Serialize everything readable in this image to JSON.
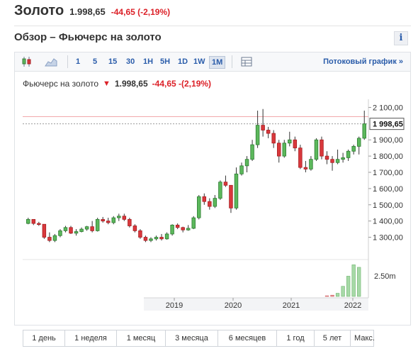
{
  "header": {
    "title": "Золото",
    "price": "1.998,65",
    "change": "-44,65 (-2,19%)"
  },
  "subtitle": "Обзор – Фьючерс на золото",
  "info_icon": "i",
  "toolbar": {
    "ranges": [
      "1",
      "5",
      "15",
      "30",
      "1H",
      "5H",
      "1D",
      "1W",
      "1M"
    ],
    "active_range": "1M",
    "stream_label": "Потоковый график  »"
  },
  "legend": {
    "name": "Фьючерс на золото",
    "price": "1.998,65",
    "change": "-44,65 -(2,19%)"
  },
  "chart_data": {
    "type": "candlestick",
    "instrument": "Фьючерс на золото",
    "last_price": "1 998,65",
    "y_ticks": [
      "2 100,00",
      "1 900,00",
      "1 800,00",
      "1 700,00",
      "1 600,00",
      "1 500,00",
      "1 400,00",
      "1 300,00"
    ],
    "y_range": [
      1180,
      2150
    ],
    "x_ticks": [
      "2019",
      "2020",
      "2021",
      "2022"
    ],
    "volume_label": "2.50m",
    "colors": {
      "up": "#5cb85c",
      "down": "#d9383c",
      "up_edge": "#2e7d32",
      "down_edge": "#a81e22"
    },
    "candles": [
      [
        1385,
        1420,
        1380,
        1410
      ],
      [
        1410,
        1410,
        1375,
        1385
      ],
      [
        1385,
        1395,
        1370,
        1380
      ],
      [
        1380,
        1380,
        1290,
        1300
      ],
      [
        1300,
        1330,
        1270,
        1280
      ],
      [
        1280,
        1320,
        1270,
        1310
      ],
      [
        1310,
        1350,
        1300,
        1340
      ],
      [
        1340,
        1370,
        1330,
        1360
      ],
      [
        1360,
        1370,
        1320,
        1325
      ],
      [
        1325,
        1350,
        1310,
        1335
      ],
      [
        1335,
        1360,
        1330,
        1350
      ],
      [
        1350,
        1370,
        1340,
        1365
      ],
      [
        1365,
        1400,
        1330,
        1340
      ],
      [
        1340,
        1420,
        1335,
        1410
      ],
      [
        1410,
        1425,
        1390,
        1400
      ],
      [
        1400,
        1420,
        1380,
        1390
      ],
      [
        1390,
        1430,
        1380,
        1420
      ],
      [
        1420,
        1445,
        1400,
        1430
      ],
      [
        1430,
        1445,
        1400,
        1410
      ],
      [
        1410,
        1420,
        1360,
        1370
      ],
      [
        1370,
        1380,
        1330,
        1340
      ],
      [
        1340,
        1350,
        1290,
        1300
      ],
      [
        1300,
        1310,
        1270,
        1280
      ],
      [
        1280,
        1300,
        1270,
        1290
      ],
      [
        1290,
        1310,
        1280,
        1300
      ],
      [
        1300,
        1320,
        1280,
        1290
      ],
      [
        1290,
        1330,
        1285,
        1320
      ],
      [
        1320,
        1380,
        1310,
        1375
      ],
      [
        1375,
        1385,
        1350,
        1360
      ],
      [
        1360,
        1365,
        1330,
        1345
      ],
      [
        1345,
        1375,
        1340,
        1355
      ],
      [
        1355,
        1430,
        1350,
        1420
      ],
      [
        1420,
        1560,
        1410,
        1550
      ],
      [
        1550,
        1570,
        1500,
        1520
      ],
      [
        1520,
        1540,
        1470,
        1490
      ],
      [
        1490,
        1560,
        1480,
        1540
      ],
      [
        1540,
        1650,
        1530,
        1640
      ],
      [
        1640,
        1680,
        1610,
        1620
      ],
      [
        1620,
        1620,
        1450,
        1480
      ],
      [
        1480,
        1730,
        1470,
        1690
      ],
      [
        1690,
        1760,
        1680,
        1740
      ],
      [
        1740,
        1800,
        1700,
        1780
      ],
      [
        1780,
        1900,
        1770,
        1870
      ],
      [
        1870,
        2080,
        1850,
        1990
      ],
      [
        1990,
        2090,
        1920,
        1960
      ],
      [
        1960,
        1980,
        1910,
        1940
      ],
      [
        1940,
        1960,
        1850,
        1880
      ],
      [
        1880,
        1900,
        1760,
        1800
      ],
      [
        1800,
        1900,
        1790,
        1880
      ],
      [
        1880,
        1950,
        1860,
        1900
      ],
      [
        1900,
        1920,
        1830,
        1850
      ],
      [
        1850,
        1870,
        1720,
        1730
      ],
      [
        1730,
        1770,
        1700,
        1720
      ],
      [
        1720,
        1800,
        1710,
        1780
      ],
      [
        1780,
        1910,
        1770,
        1900
      ],
      [
        1900,
        1920,
        1780,
        1800
      ],
      [
        1800,
        1830,
        1750,
        1780
      ],
      [
        1780,
        1800,
        1710,
        1760
      ],
      [
        1760,
        1840,
        1750,
        1780
      ],
      [
        1780,
        1820,
        1760,
        1790
      ],
      [
        1790,
        1840,
        1770,
        1830
      ],
      [
        1830,
        1870,
        1810,
        1860
      ],
      [
        1860,
        1920,
        1810,
        1910
      ],
      [
        1910,
        2080,
        1900,
        1998.65
      ]
    ],
    "volumes": [
      0,
      0,
      0,
      0,
      0,
      0,
      0,
      0,
      0,
      0,
      0,
      0,
      0,
      0,
      0,
      0,
      0,
      0,
      0,
      0,
      0,
      0,
      0,
      0,
      0,
      0,
      0,
      0,
      0,
      0,
      0,
      0,
      0,
      0,
      0,
      0,
      0,
      0,
      0,
      0,
      0,
      0,
      0,
      0,
      0,
      0,
      0,
      0,
      0,
      0,
      0,
      0,
      0,
      0,
      0,
      0,
      0.05,
      0.1,
      0.25,
      0.8,
      1.6,
      2.5,
      2.3,
      0
    ]
  },
  "period_buttons": [
    "1 день",
    "1 неделя",
    "1 месяц",
    "3 месяца",
    "6 месяцев",
    "1 год",
    "5 лет",
    "Макс."
  ]
}
